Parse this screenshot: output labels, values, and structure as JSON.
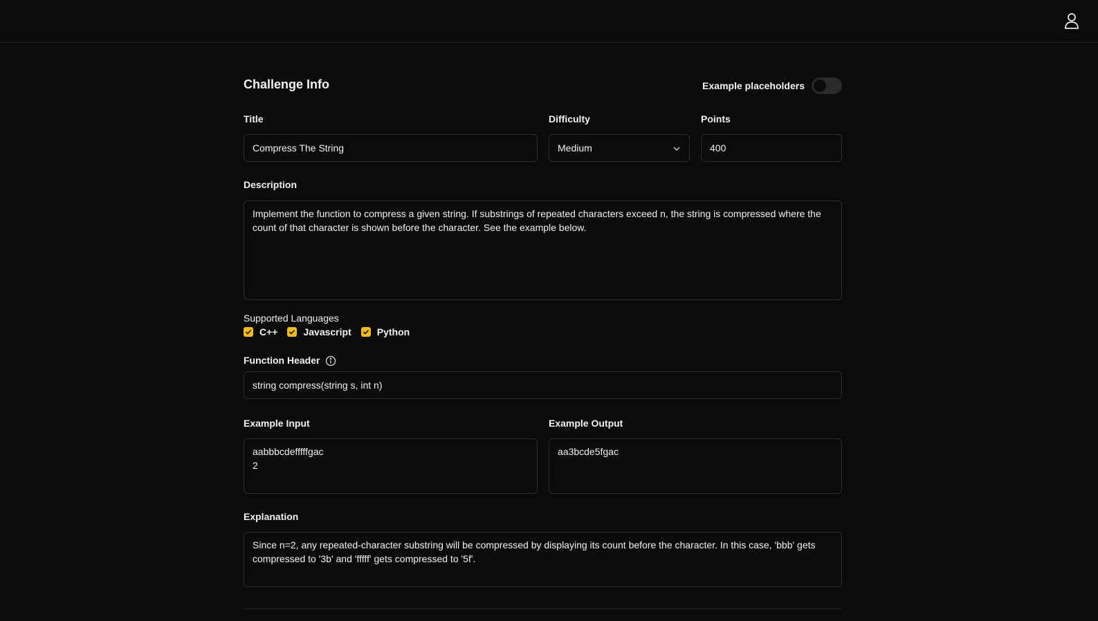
{
  "header": {
    "user_icon": "user-icon"
  },
  "challenge": {
    "section_title": "Challenge Info",
    "example_placeholders_label": "Example placeholders",
    "example_placeholders_on": false,
    "title_label": "Title",
    "title_value": "Compress The String",
    "difficulty_label": "Difficulty",
    "difficulty_value": "Medium",
    "points_label": "Points",
    "points_value": "400",
    "description_label": "Description",
    "description_value": "Implement the function to compress a given string. If substrings of repeated characters exceed n, the string is compressed where the count of that character is shown before the character. See the example below.",
    "languages_label": "Supported Languages",
    "languages": [
      {
        "label": "C++",
        "checked": true
      },
      {
        "label": "Javascript",
        "checked": true
      },
      {
        "label": "Python",
        "checked": true
      }
    ],
    "function_header_label": "Function Header",
    "function_header_value": "string compress(string s, int n)",
    "example_input_label": "Example Input",
    "example_input_value": "aabbbcdefffffgac\n2",
    "example_output_label": "Example Output",
    "example_output_value": "aa3bcde5fgac",
    "explanation_label": "Explanation",
    "explanation_value": "Since n=2, any repeated-character substring will be compressed by displaying its count before the character. In this case, 'bbb' gets compressed to '3b' and 'fffff' gets compressed to '5f'."
  },
  "colors": {
    "background": "#0b0b0b",
    "checkbox_accent": "#f2bb19",
    "border": "#2c2c2c"
  }
}
